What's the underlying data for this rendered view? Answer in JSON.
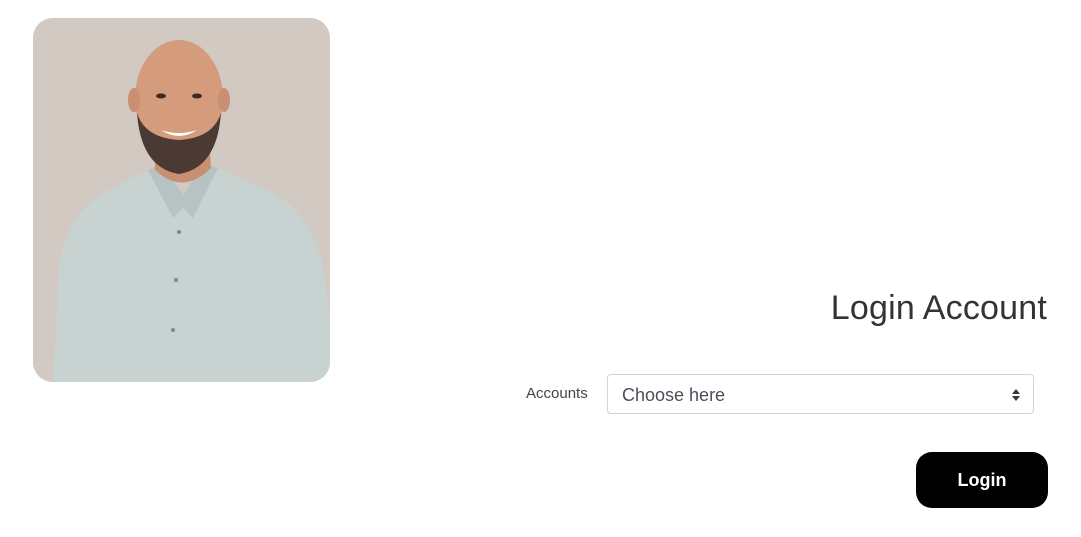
{
  "photo": {
    "subject": "portrait-photo",
    "background_color": "#d3c9c3",
    "shirt_color": "#c9d4d3"
  },
  "login": {
    "title": "Login Account",
    "accounts_label": "Accounts",
    "select": {
      "selected_value": "Choose here"
    },
    "button_label": "Login",
    "button_color": "#000000"
  }
}
